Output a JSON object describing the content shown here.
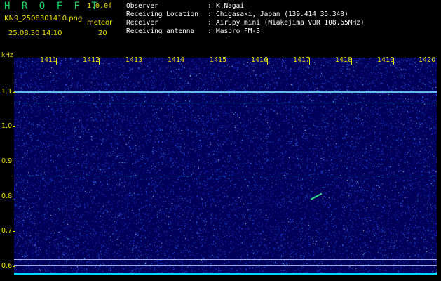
{
  "header": {
    "app_title": "H R O F F T",
    "version": "1.0.0f",
    "filename": "KN9_2508301410.png",
    "meteor_label": "meteor",
    "datetime": "25.08.30 14:10",
    "meteor_count": "20"
  },
  "info": [
    {
      "label": "Observer",
      "value": "K.Nagai"
    },
    {
      "label": "Receiving Location",
      "value": "Chigasaki, Japan (139.414 35.340)"
    },
    {
      "label": "Receiver",
      "value": "AirSpy mini (Miakejima VOR 108.65MHz)"
    },
    {
      "label": "Receiving antenna",
      "value": "Maspro FM-3"
    }
  ],
  "separator": ":",
  "axis": {
    "unit": "kHz",
    "x_ticks": [
      "1411",
      "1412",
      "1413",
      "1414",
      "1415",
      "1416",
      "1417",
      "1418",
      "1419",
      "1420"
    ],
    "y_ticks": [
      "1.1",
      "1.0",
      "0.9",
      "0.8",
      "0.7",
      "0.6"
    ]
  },
  "colors": {
    "background": "#000000",
    "title": "#1fd46a",
    "label": "#e8e000",
    "info_text": "#ffffff",
    "spectrogram_bg": "#00005a",
    "noise": "#2060ff",
    "band": "#00d8ff"
  }
}
